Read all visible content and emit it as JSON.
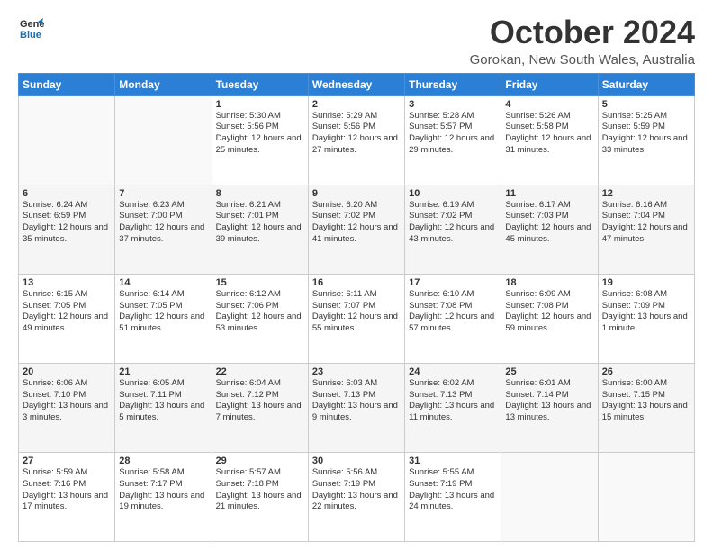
{
  "logo": {
    "line1": "General",
    "line2": "Blue"
  },
  "title": "October 2024",
  "subtitle": "Gorokan, New South Wales, Australia",
  "header_days": [
    "Sunday",
    "Monday",
    "Tuesday",
    "Wednesday",
    "Thursday",
    "Friday",
    "Saturday"
  ],
  "weeks": [
    [
      {
        "day": "",
        "sunrise": "",
        "sunset": "",
        "daylight": ""
      },
      {
        "day": "",
        "sunrise": "",
        "sunset": "",
        "daylight": ""
      },
      {
        "day": "1",
        "sunrise": "Sunrise: 5:30 AM",
        "sunset": "Sunset: 5:56 PM",
        "daylight": "Daylight: 12 hours and 25 minutes."
      },
      {
        "day": "2",
        "sunrise": "Sunrise: 5:29 AM",
        "sunset": "Sunset: 5:56 PM",
        "daylight": "Daylight: 12 hours and 27 minutes."
      },
      {
        "day": "3",
        "sunrise": "Sunrise: 5:28 AM",
        "sunset": "Sunset: 5:57 PM",
        "daylight": "Daylight: 12 hours and 29 minutes."
      },
      {
        "day": "4",
        "sunrise": "Sunrise: 5:26 AM",
        "sunset": "Sunset: 5:58 PM",
        "daylight": "Daylight: 12 hours and 31 minutes."
      },
      {
        "day": "5",
        "sunrise": "Sunrise: 5:25 AM",
        "sunset": "Sunset: 5:59 PM",
        "daylight": "Daylight: 12 hours and 33 minutes."
      }
    ],
    [
      {
        "day": "6",
        "sunrise": "Sunrise: 6:24 AM",
        "sunset": "Sunset: 6:59 PM",
        "daylight": "Daylight: 12 hours and 35 minutes."
      },
      {
        "day": "7",
        "sunrise": "Sunrise: 6:23 AM",
        "sunset": "Sunset: 7:00 PM",
        "daylight": "Daylight: 12 hours and 37 minutes."
      },
      {
        "day": "8",
        "sunrise": "Sunrise: 6:21 AM",
        "sunset": "Sunset: 7:01 PM",
        "daylight": "Daylight: 12 hours and 39 minutes."
      },
      {
        "day": "9",
        "sunrise": "Sunrise: 6:20 AM",
        "sunset": "Sunset: 7:02 PM",
        "daylight": "Daylight: 12 hours and 41 minutes."
      },
      {
        "day": "10",
        "sunrise": "Sunrise: 6:19 AM",
        "sunset": "Sunset: 7:02 PM",
        "daylight": "Daylight: 12 hours and 43 minutes."
      },
      {
        "day": "11",
        "sunrise": "Sunrise: 6:17 AM",
        "sunset": "Sunset: 7:03 PM",
        "daylight": "Daylight: 12 hours and 45 minutes."
      },
      {
        "day": "12",
        "sunrise": "Sunrise: 6:16 AM",
        "sunset": "Sunset: 7:04 PM",
        "daylight": "Daylight: 12 hours and 47 minutes."
      }
    ],
    [
      {
        "day": "13",
        "sunrise": "Sunrise: 6:15 AM",
        "sunset": "Sunset: 7:05 PM",
        "daylight": "Daylight: 12 hours and 49 minutes."
      },
      {
        "day": "14",
        "sunrise": "Sunrise: 6:14 AM",
        "sunset": "Sunset: 7:05 PM",
        "daylight": "Daylight: 12 hours and 51 minutes."
      },
      {
        "day": "15",
        "sunrise": "Sunrise: 6:12 AM",
        "sunset": "Sunset: 7:06 PM",
        "daylight": "Daylight: 12 hours and 53 minutes."
      },
      {
        "day": "16",
        "sunrise": "Sunrise: 6:11 AM",
        "sunset": "Sunset: 7:07 PM",
        "daylight": "Daylight: 12 hours and 55 minutes."
      },
      {
        "day": "17",
        "sunrise": "Sunrise: 6:10 AM",
        "sunset": "Sunset: 7:08 PM",
        "daylight": "Daylight: 12 hours and 57 minutes."
      },
      {
        "day": "18",
        "sunrise": "Sunrise: 6:09 AM",
        "sunset": "Sunset: 7:08 PM",
        "daylight": "Daylight: 12 hours and 59 minutes."
      },
      {
        "day": "19",
        "sunrise": "Sunrise: 6:08 AM",
        "sunset": "Sunset: 7:09 PM",
        "daylight": "Daylight: 13 hours and 1 minute."
      }
    ],
    [
      {
        "day": "20",
        "sunrise": "Sunrise: 6:06 AM",
        "sunset": "Sunset: 7:10 PM",
        "daylight": "Daylight: 13 hours and 3 minutes."
      },
      {
        "day": "21",
        "sunrise": "Sunrise: 6:05 AM",
        "sunset": "Sunset: 7:11 PM",
        "daylight": "Daylight: 13 hours and 5 minutes."
      },
      {
        "day": "22",
        "sunrise": "Sunrise: 6:04 AM",
        "sunset": "Sunset: 7:12 PM",
        "daylight": "Daylight: 13 hours and 7 minutes."
      },
      {
        "day": "23",
        "sunrise": "Sunrise: 6:03 AM",
        "sunset": "Sunset: 7:13 PM",
        "daylight": "Daylight: 13 hours and 9 minutes."
      },
      {
        "day": "24",
        "sunrise": "Sunrise: 6:02 AM",
        "sunset": "Sunset: 7:13 PM",
        "daylight": "Daylight: 13 hours and 11 minutes."
      },
      {
        "day": "25",
        "sunrise": "Sunrise: 6:01 AM",
        "sunset": "Sunset: 7:14 PM",
        "daylight": "Daylight: 13 hours and 13 minutes."
      },
      {
        "day": "26",
        "sunrise": "Sunrise: 6:00 AM",
        "sunset": "Sunset: 7:15 PM",
        "daylight": "Daylight: 13 hours and 15 minutes."
      }
    ],
    [
      {
        "day": "27",
        "sunrise": "Sunrise: 5:59 AM",
        "sunset": "Sunset: 7:16 PM",
        "daylight": "Daylight: 13 hours and 17 minutes."
      },
      {
        "day": "28",
        "sunrise": "Sunrise: 5:58 AM",
        "sunset": "Sunset: 7:17 PM",
        "daylight": "Daylight: 13 hours and 19 minutes."
      },
      {
        "day": "29",
        "sunrise": "Sunrise: 5:57 AM",
        "sunset": "Sunset: 7:18 PM",
        "daylight": "Daylight: 13 hours and 21 minutes."
      },
      {
        "day": "30",
        "sunrise": "Sunrise: 5:56 AM",
        "sunset": "Sunset: 7:19 PM",
        "daylight": "Daylight: 13 hours and 22 minutes."
      },
      {
        "day": "31",
        "sunrise": "Sunrise: 5:55 AM",
        "sunset": "Sunset: 7:19 PM",
        "daylight": "Daylight: 13 hours and 24 minutes."
      },
      {
        "day": "",
        "sunrise": "",
        "sunset": "",
        "daylight": ""
      },
      {
        "day": "",
        "sunrise": "",
        "sunset": "",
        "daylight": ""
      }
    ]
  ]
}
